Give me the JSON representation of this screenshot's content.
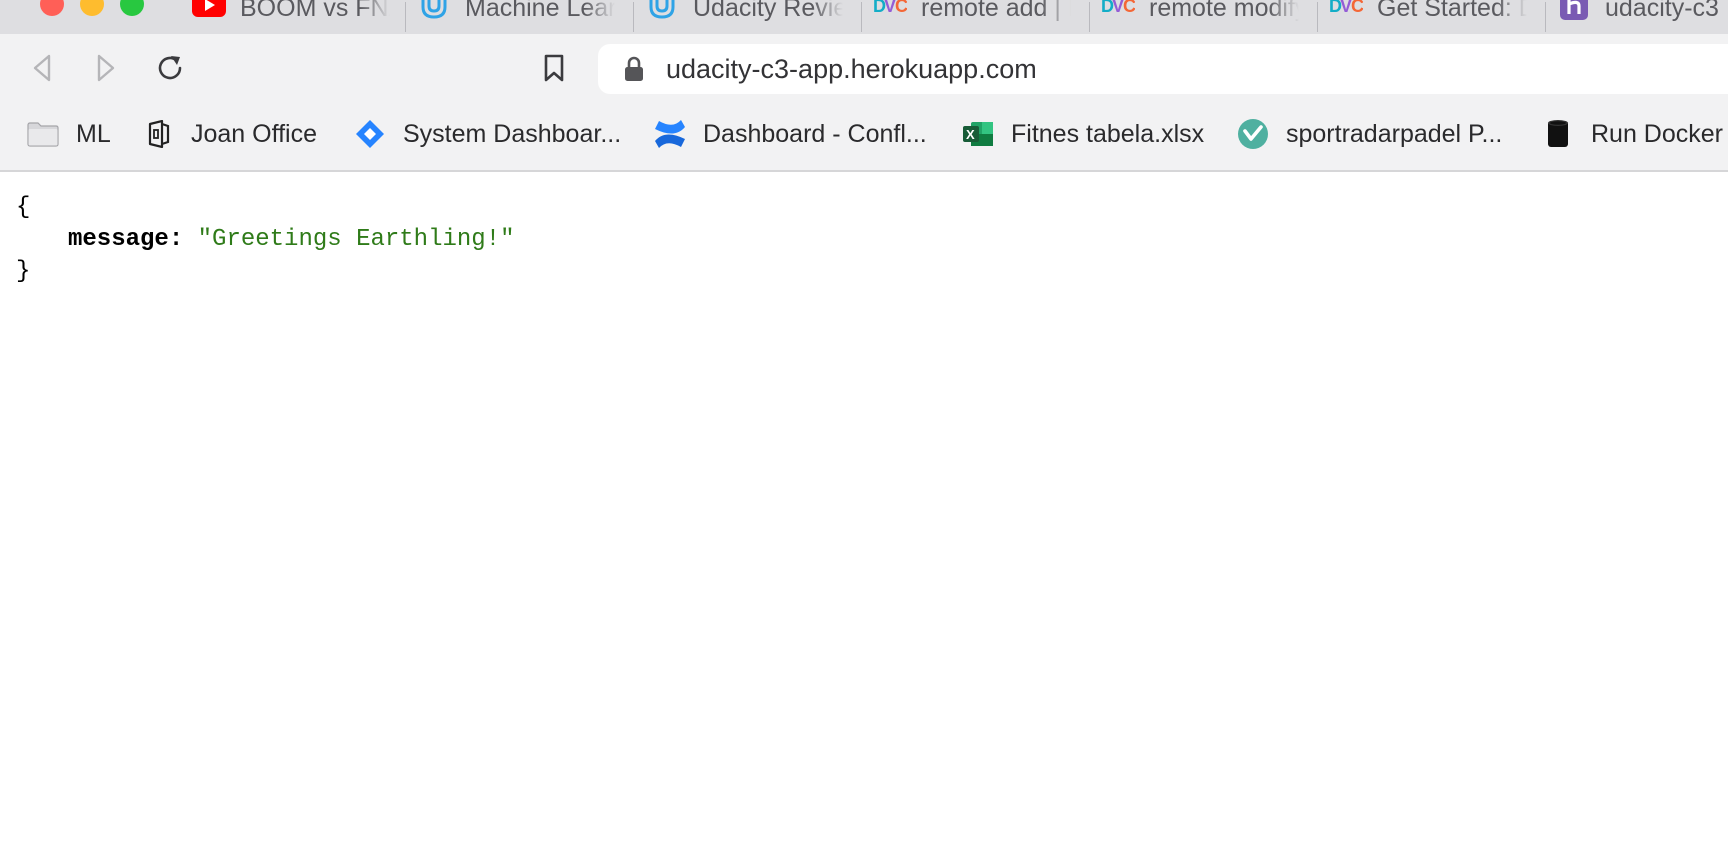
{
  "tabs": [
    {
      "title": "BOOM vs FNATIC",
      "icon": "youtube-icon"
    },
    {
      "title": "Machine Learning",
      "icon": "udacity-icon"
    },
    {
      "title": "Udacity Reviews",
      "icon": "udacity-icon"
    },
    {
      "title": "remote add | DVC",
      "icon": "dvc-icon"
    },
    {
      "title": "remote modify | DVC",
      "icon": "dvc-icon"
    },
    {
      "title": "Get Started: DVC",
      "icon": "dvc-icon"
    },
    {
      "title": "udacity-c3",
      "icon": "heroku-icon"
    }
  ],
  "toolbar": {
    "url": "udacity-c3-app.herokuapp.com"
  },
  "bookmarks": [
    {
      "label": "ML",
      "icon": "folder-icon"
    },
    {
      "label": "Joan Office",
      "icon": "office-icon"
    },
    {
      "label": "System Dashboar...",
      "icon": "jira-icon"
    },
    {
      "label": "Dashboard - Confl...",
      "icon": "confluence-icon"
    },
    {
      "label": "Fitnes tabela.xlsx",
      "icon": "excel-icon"
    },
    {
      "label": "sportradarpadel P...",
      "icon": "check-badge-icon"
    },
    {
      "label": "Run Docker",
      "icon": "docker-db-icon"
    }
  ],
  "json": {
    "open_brace": "{",
    "key": "message",
    "colon": ":",
    "value": "\"Greetings Earthling!\"",
    "close_brace": "}"
  },
  "colors": {
    "json_string": "#2f7b19",
    "tab_strip": "#dedee1",
    "toolbar": "#f2f2f3"
  }
}
